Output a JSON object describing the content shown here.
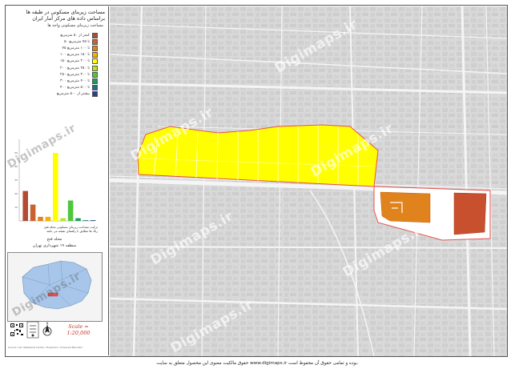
{
  "map": {
    "title_line1": "مساحت زیربنای مسکونی در طبقه ها",
    "title_line2": "براساس داده های مرکز آمار ایران",
    "legend_header": "مساحت زیربنای مسکونی واحد ها",
    "legend": [
      {
        "label": "کمتر از ۵۰ مترمربع",
        "color": "#b34a32"
      },
      {
        "label": "۵۰ تا ۷۵ مترمربع",
        "color": "#c9622e"
      },
      {
        "label": "۷۵ تا ۱۰۰ مترمربع",
        "color": "#e0831d"
      },
      {
        "label": "۱۰۰ تا ۱۵۰ مترمربع",
        "color": "#f0b400"
      },
      {
        "label": "۱۵۰ تا ۲۰۰ مترمربع",
        "color": "#ffff00"
      },
      {
        "label": "۲۰۰ تا ۲۵۰ مترمربع",
        "color": "#b5e61d"
      },
      {
        "label": "۲۵۰ تا ۳۰۰ مترمربع",
        "color": "#4cc83c"
      },
      {
        "label": "۳۰۰ تا ۴۰۰ مترمربع",
        "color": "#1a9e57"
      },
      {
        "label": "۴۰۰ تا ۵۰۰ مترمربع",
        "color": "#1d6f8e"
      },
      {
        "label": "بیشتر از ۵۰۰ مترمربع",
        "color": "#2b3f8c"
      }
    ],
    "chart_caption": "ترکیب مساحت زیربنای مسکونی محله فتح",
    "chart_caption2": "رنگ ها مطابق با راهنمای نقشه می باشد",
    "location_title": "محله فتح",
    "location_sub": "منطقه ۱۹ شهرداری تهران",
    "scale": "Scale = 1:20,000",
    "footer": "حقوق مالکیت معنوی این محصول متعلق به سایت www.digimaps.ir بوده و تمامی حقوق آن محفوظ است.",
    "small_note": "Source: Iran Statistical Center / Projection: Universal Mercator",
    "watermark": "Digimaps.ir",
    "highlight_color": "#ffff00",
    "boundary_color": "#e8524f"
  },
  "chart_data": {
    "type": "bar",
    "categories": [
      "<50",
      "50-75",
      "75-100",
      "100-150",
      "150-200",
      "200-250",
      "250-300",
      "300-400",
      "400-500",
      ">500"
    ],
    "values": [
      22,
      12,
      3,
      3,
      50,
      2,
      15,
      2,
      0.5,
      0.5
    ],
    "colors": [
      "#b34a32",
      "#c9622e",
      "#e0831d",
      "#f0b400",
      "#ffff00",
      "#b5e61d",
      "#4cc83c",
      "#1a9e57",
      "#1d6f8e",
      "#2b3f8c"
    ],
    "ylim": [
      0,
      60
    ],
    "ytick_values": [
      10,
      20,
      30,
      40,
      50
    ]
  }
}
